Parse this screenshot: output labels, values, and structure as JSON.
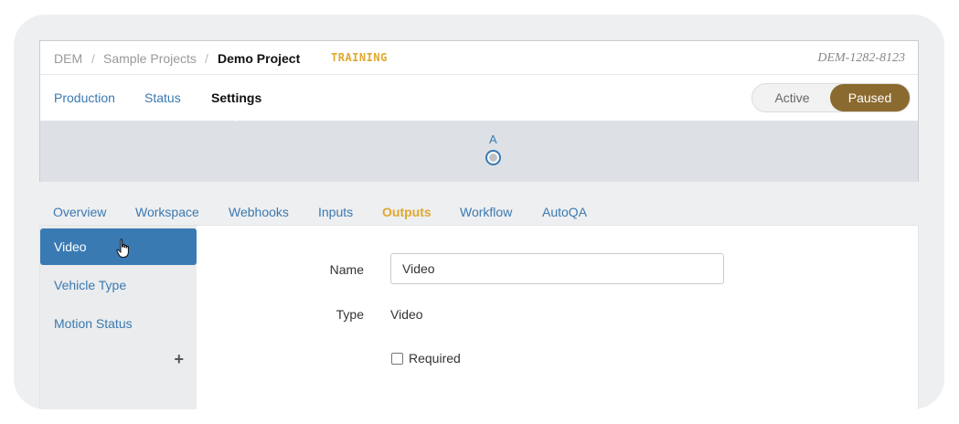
{
  "breadcrumb": {
    "items": [
      "DEM",
      "Sample Projects"
    ],
    "separator": "/",
    "current": "Demo Project"
  },
  "badge": "TRAINING",
  "project_id": "DEM-1282-8123",
  "nav": {
    "items": [
      "Production",
      "Status",
      "Settings"
    ],
    "active": "Settings"
  },
  "status_toggle": {
    "options": [
      "Active",
      "Paused"
    ],
    "selected": "Paused"
  },
  "stage": {
    "label": "A"
  },
  "tabs": {
    "items": [
      "Overview",
      "Workspace",
      "Webhooks",
      "Inputs",
      "Outputs",
      "Workflow",
      "AutoQA"
    ],
    "active": "Outputs"
  },
  "sidebar": {
    "items": [
      "Video",
      "Vehicle Type",
      "Motion Status"
    ],
    "active": "Video",
    "add_icon": "+"
  },
  "form": {
    "name_label": "Name",
    "name_value": "Video",
    "type_label": "Type",
    "type_value": "Video",
    "required_label": "Required",
    "required_checked": false
  },
  "colors": {
    "accent_gold": "#8b6a2f",
    "training_badge": "#e0a82e",
    "link_blue": "#3a79b0",
    "sidebar_active": "#3a7ab3"
  }
}
